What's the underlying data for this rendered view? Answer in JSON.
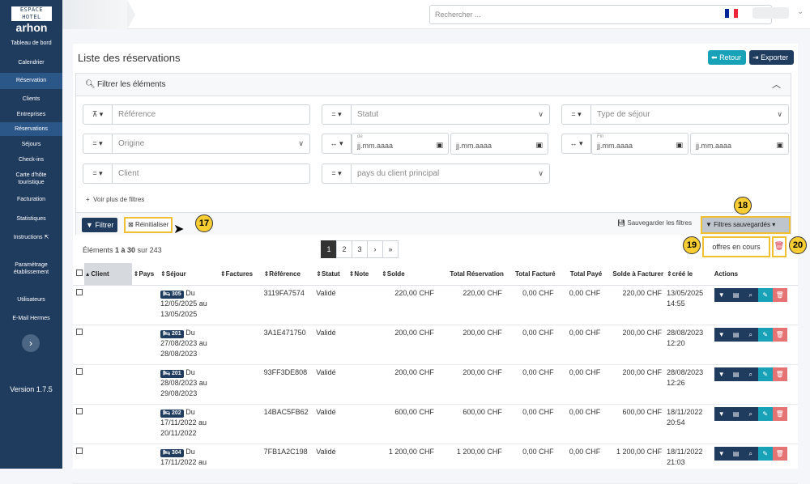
{
  "sidebar": {
    "logo_top": "ESPACE HOTEL",
    "logo_bottom": "arhon",
    "items": [
      {
        "label": "Tableau de bord",
        "active": false
      },
      {
        "label": "Calendrier",
        "active": false
      },
      {
        "label": "Réservation",
        "active": true
      },
      {
        "label": "Clients",
        "active": false
      },
      {
        "label": "Entreprises",
        "active": false
      },
      {
        "label": "Réservations",
        "active": true
      },
      {
        "label": "Séjours",
        "active": false
      },
      {
        "label": "Check-ins",
        "active": false
      },
      {
        "label": "Carte d'hôte touristique",
        "active": false
      },
      {
        "label": "Facturation",
        "active": false
      },
      {
        "label": "Statistiques",
        "active": false
      },
      {
        "label": "Instructions",
        "active": false
      },
      {
        "label": "Paramétrage établissement",
        "active": false
      },
      {
        "label": "Utilisateurs",
        "active": false
      },
      {
        "label": "E-Mail Hermes",
        "active": false
      }
    ],
    "collapse_icon": "chevron-right-icon",
    "version": "Version 1.7.5"
  },
  "topbar": {
    "search_placeholder": "Rechercher ...",
    "flag_colors": [
      "#002395",
      "#ffffff",
      "#ed2939"
    ]
  },
  "page": {
    "title": "Liste des réservations",
    "retour_label": "Retour",
    "exporter_label": "Exporter"
  },
  "filters": {
    "header": "Filtrer les éléments",
    "reference_placeholder": "Référence",
    "statut_placeholder": "Statut",
    "type_sejour_placeholder": "Type de séjour",
    "origine_placeholder": "Origine",
    "date_de_label": "de",
    "date_fin_label": "Fin",
    "date_placeholder": "jj.mm.aaaa",
    "client_placeholder": "Client",
    "pays_placeholder": "pays du client principal",
    "more_filters": "Voir plus de filtres",
    "filtrer_label": "Filtrer",
    "reset_label": "Réinitialiser",
    "save_filters_label": "Sauvegarder les filtres",
    "saved_filters_label": "Filtres sauvegardés",
    "saved_filter_item": "offres en cours"
  },
  "annotations": {
    "b17": "17",
    "b18": "18",
    "b19": "19",
    "b20": "20"
  },
  "table": {
    "info_prefix": "Éléments ",
    "info_range": "1 à 30",
    "info_suffix": " sur 243",
    "pages": [
      "1",
      "2",
      "3",
      "›",
      "»"
    ],
    "columns": [
      "Client",
      "Pays",
      "Séjour",
      "Factures",
      "Référence",
      "Statut",
      "Note",
      "Solde",
      "Total Réservation",
      "Total Facturé",
      "Total Payé",
      "Solde à Facturer",
      "créé le",
      "Actions"
    ],
    "rows": [
      {
        "room": "305",
        "sejour": "Du 12/05/2025 au 13/05/2025",
        "ref": "3119FA7574",
        "statut": "Validé",
        "solde": "220,00 CHF",
        "total": "220,00 CHF",
        "facture": "0,00 CHF",
        "paye": "0,00 CHF",
        "afacturer": "220,00 CHF",
        "cree": "13/05/2025 14:55"
      },
      {
        "room": "201",
        "sejour": "Du 27/08/2023 au 28/08/2023",
        "ref": "3A1E471750",
        "statut": "Validé",
        "solde": "200,00 CHF",
        "total": "200,00 CHF",
        "facture": "0,00 CHF",
        "paye": "0,00 CHF",
        "afacturer": "200,00 CHF",
        "cree": "28/08/2023 12:20"
      },
      {
        "room": "201",
        "sejour": "Du 28/08/2023 au 29/08/2023",
        "ref": "93FF3DE808",
        "statut": "Validé",
        "solde": "200,00 CHF",
        "total": "200,00 CHF",
        "facture": "0,00 CHF",
        "paye": "0,00 CHF",
        "afacturer": "200,00 CHF",
        "cree": "28/08/2023 12:26"
      },
      {
        "room": "202",
        "sejour": "Du 17/11/2022 au 20/11/2022",
        "ref": "14BAC5FB62",
        "statut": "Validé",
        "solde": "600,00 CHF",
        "total": "600,00 CHF",
        "facture": "0,00 CHF",
        "paye": "0,00 CHF",
        "afacturer": "600,00 CHF",
        "cree": "18/11/2022 20:54"
      },
      {
        "room": "304",
        "sejour": "Du 17/11/2022 au",
        "ref": "7FB1A2C198",
        "statut": "Validé",
        "solde": "1 200,00 CHF",
        "total": "1 200,00 CHF",
        "facture": "0,00 CHF",
        "paye": "0,00 CHF",
        "afacturer": "1 200,00 CHF",
        "cree": "18/11/2022 21:03"
      }
    ]
  }
}
